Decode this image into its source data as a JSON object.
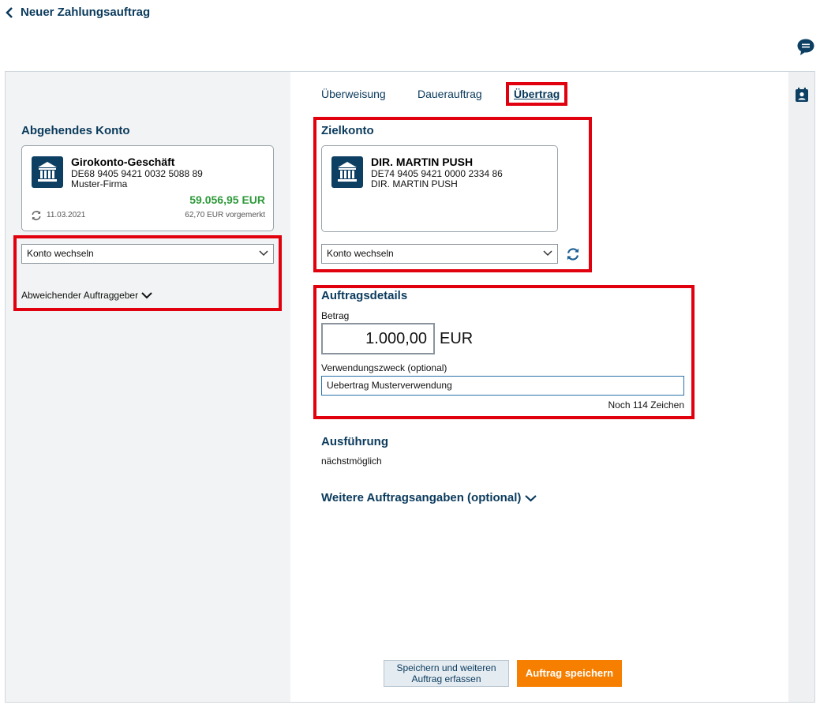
{
  "header": {
    "title": "Neuer Zahlungsauftrag",
    "back_icon": "chevron-left-icon",
    "chat_icon": "chat-bubble-icon"
  },
  "sidebar_right": {
    "contact_icon": "contact-card-icon"
  },
  "source": {
    "section_title": "Abgehendes Konto",
    "account": {
      "name": "Girokonto-Geschäft",
      "iban": "DE68 9405 9421 0032 5088 89",
      "holder": "Muster-Firma",
      "balance": "59.056,95 EUR",
      "date": "11.03.2021",
      "reserved": "62,70 EUR vorgemerkt"
    },
    "switch_label": "Konto wechseln",
    "different_originator_label": "Abweichender Auftraggeber"
  },
  "tabs": [
    {
      "label": "Überweisung",
      "active": false
    },
    {
      "label": "Dauerauftrag",
      "active": false
    },
    {
      "label": "Übertrag",
      "active": true
    }
  ],
  "target": {
    "section_title": "Zielkonto",
    "account": {
      "name": "DIR. MARTIN PUSH",
      "iban": "DE74 9405 9421 0000 2334 86",
      "holder": "DIR. MARTIN PUSH"
    },
    "switch_label": "Konto wechseln"
  },
  "details": {
    "section_title": "Auftragsdetails",
    "amount_label": "Betrag",
    "amount_value": "1.000,00",
    "currency": "EUR",
    "purpose_label": "Verwendungszweck (optional)",
    "purpose_value": "Uebertrag Musterverwendung",
    "chars_left": "Noch 114 Zeichen"
  },
  "execution": {
    "section_title": "Ausführung",
    "value": "nächstmöglich"
  },
  "more_details_label": "Weitere Auftragsangaben (optional)",
  "buttons": {
    "save_and_new": "Speichern und weiteren Auftrag erfassen",
    "save": "Auftrag speichern"
  },
  "colors": {
    "brand": "#0a3a5c",
    "balance_positive": "#2e9a3a",
    "highlight": "#e0000e",
    "primary_button": "#f77f00"
  }
}
